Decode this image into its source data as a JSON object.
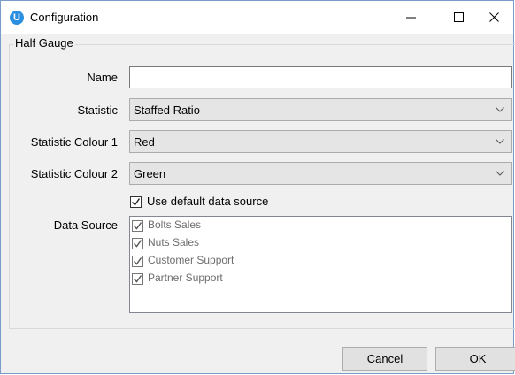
{
  "window": {
    "title": "Configuration",
    "app_icon_letter": "U",
    "controls": [
      "minimize-icon",
      "maximize-icon",
      "close-icon"
    ]
  },
  "group": {
    "label": "Half Gauge"
  },
  "fields": {
    "name_label": "Name",
    "name_value": "",
    "statistic_label": "Statistic",
    "statistic_value": "Staffed Ratio",
    "colour1_label": "Statistic Colour 1",
    "colour1_value": "Red",
    "colour2_label": "Statistic Colour 2",
    "colour2_value": "Green",
    "default_source_label": "Use default data source",
    "default_source_checked": true,
    "data_source_label": "Data Source"
  },
  "data_sources": [
    {
      "label": "Bolts Sales",
      "checked": true
    },
    {
      "label": "Nuts Sales",
      "checked": true
    },
    {
      "label": "Customer Support",
      "checked": true
    },
    {
      "label": "Partner Support",
      "checked": true
    }
  ],
  "buttons": {
    "cancel": "Cancel",
    "ok": "OK"
  }
}
